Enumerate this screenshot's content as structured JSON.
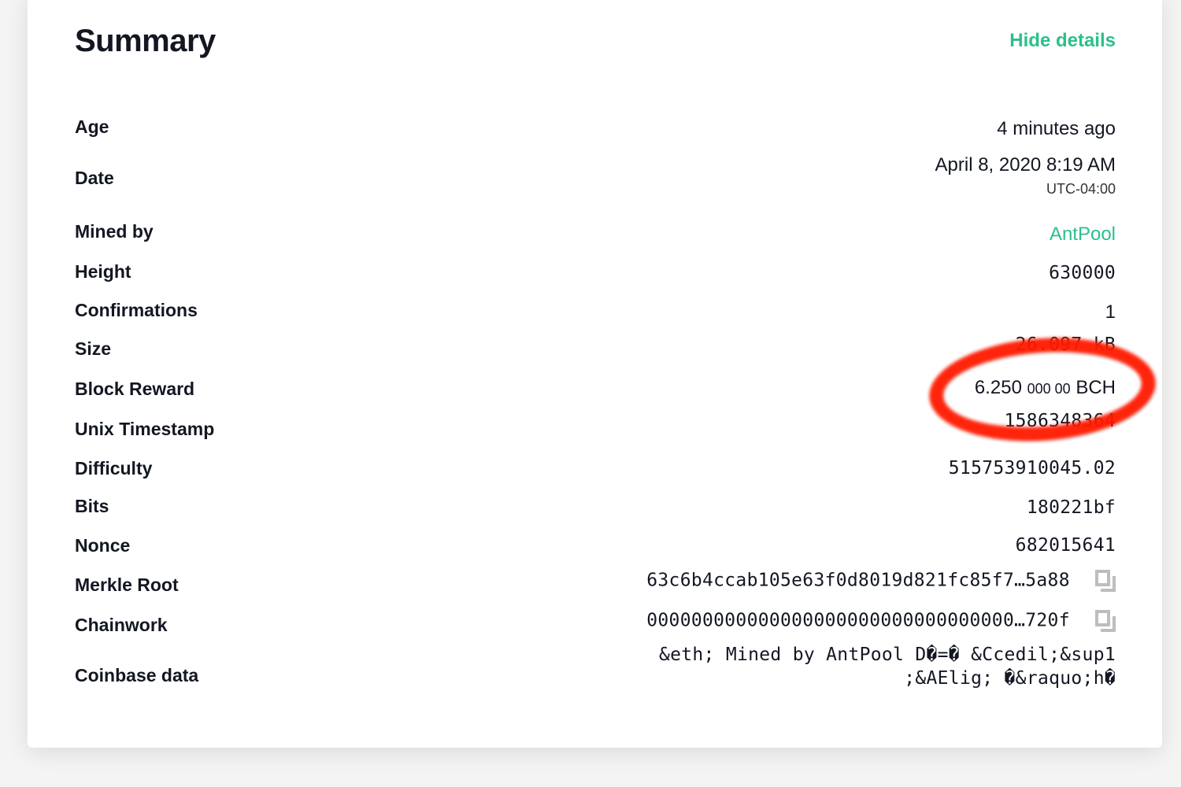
{
  "header": {
    "title": "Summary",
    "hide_details_label": "Hide details"
  },
  "rows": {
    "age": {
      "label": "Age",
      "value": "4 minutes ago"
    },
    "date": {
      "label": "Date",
      "value": "April 8, 2020 8:19 AM",
      "timezone": "UTC-04:00"
    },
    "mined_by": {
      "label": "Mined by",
      "value": "AntPool"
    },
    "height": {
      "label": "Height",
      "value": "630000"
    },
    "confirmations": {
      "label": "Confirmations",
      "value": "1"
    },
    "size": {
      "label": "Size",
      "value": "26.097 kB"
    },
    "block_reward": {
      "label": "Block Reward",
      "value_main": "6.250",
      "value_small": "000 00",
      "unit": "BCH"
    },
    "unix_timestamp": {
      "label": "Unix Timestamp",
      "value": "1586348364"
    },
    "difficulty": {
      "label": "Difficulty",
      "value": "515753910045.02"
    },
    "bits": {
      "label": "Bits",
      "value": "180221bf"
    },
    "nonce": {
      "label": "Nonce",
      "value": "682015641"
    },
    "merkle_root": {
      "label": "Merkle Root",
      "value": "63c6b4ccab105e63f0d8019d821fc85f7…5a88"
    },
    "chainwork": {
      "label": "Chainwork",
      "value": "000000000000000000000000000000000…720f"
    },
    "coinbase_data": {
      "label": "Coinbase data",
      "line1": "&eth; Mined by AntPool D�=� &Ccedil;&sup1",
      "line2": ";&AElig; �&raquo;h�"
    }
  },
  "colors": {
    "accent": "#2bc08a",
    "annotation": "#ff1a00"
  }
}
